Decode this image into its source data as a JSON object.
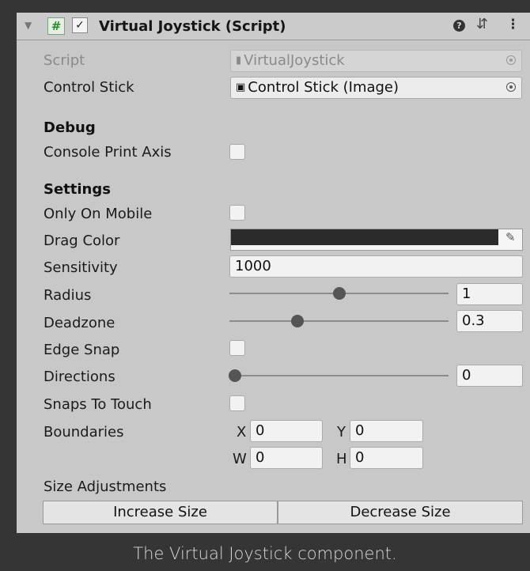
{
  "component": {
    "title": "Virtual Joystick (Script)",
    "enabled": true,
    "icons": {
      "fold": "triangle-down-icon",
      "script": "script-icon",
      "help": "help-icon",
      "preset": "preset-icon",
      "more": "more-icon"
    }
  },
  "fields": {
    "script": {
      "label": "Script",
      "value": "VirtualJoystick"
    },
    "control_stick": {
      "label": "Control Stick",
      "value": "Control Stick (Image)"
    }
  },
  "debug": {
    "heading": "Debug",
    "console_print_axis": {
      "label": "Console Print Axis",
      "checked": false
    }
  },
  "settings": {
    "heading": "Settings",
    "only_on_mobile": {
      "label": "Only On Mobile",
      "checked": false
    },
    "drag_color": {
      "label": "Drag Color",
      "color": "#2b2b2b"
    },
    "sensitivity": {
      "label": "Sensitivity",
      "value": "1000"
    },
    "radius": {
      "label": "Radius",
      "value": "1",
      "slider_fraction": 0.5
    },
    "deadzone": {
      "label": "Deadzone",
      "value": "0.3",
      "slider_fraction": 0.3
    },
    "edge_snap": {
      "label": "Edge Snap",
      "checked": false
    },
    "directions": {
      "label": "Directions",
      "value": "0",
      "slider_fraction": 0.0
    },
    "snaps_to_touch": {
      "label": "Snaps To Touch",
      "checked": false
    },
    "boundaries": {
      "label": "Boundaries",
      "x_label": "X",
      "x": "0",
      "y_label": "Y",
      "y": "0",
      "w_label": "W",
      "w": "0",
      "h_label": "H",
      "h": "0"
    }
  },
  "size_adjustments": {
    "label": "Size Adjustments",
    "increase_label": "Increase Size",
    "decrease_label": "Decrease Size"
  },
  "caption": "The Virtual Joystick component."
}
